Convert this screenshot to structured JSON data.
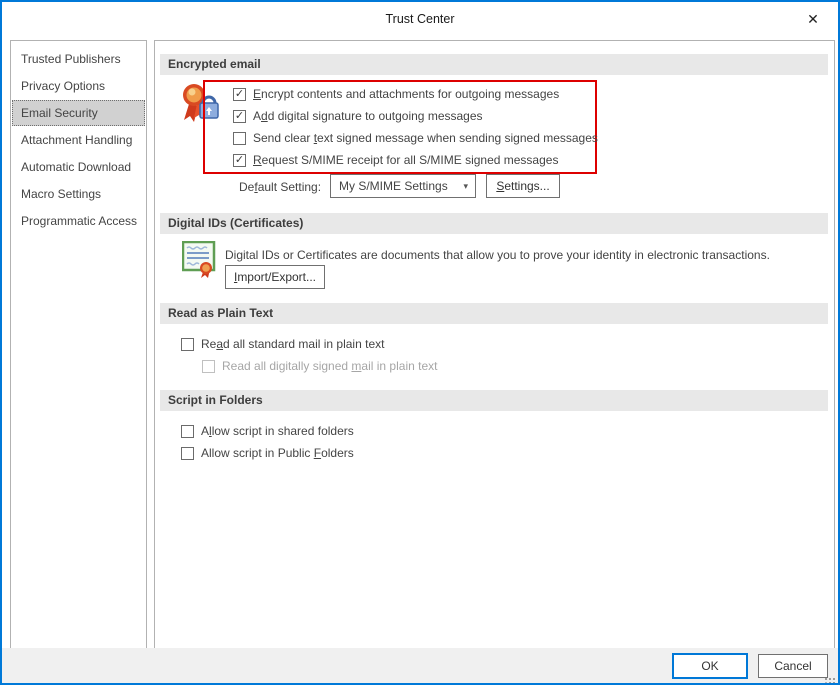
{
  "window": {
    "title": "Trust Center"
  },
  "icons": {
    "close_glyph": "✕",
    "check_glyph": "✓",
    "dropdown_arrow": "▾"
  },
  "colors": {
    "accent_blue": "#0078d7",
    "window_border": "#0079d8",
    "annotation_red": "#dd0000",
    "section_bar_gray": "#e8e8e8",
    "sidebar_selected_gray": "#d1d1d1"
  },
  "sidebar": {
    "items": [
      {
        "label": "Trusted Publishers",
        "selected": false
      },
      {
        "label": "Privacy Options",
        "selected": false
      },
      {
        "label": "Email Security",
        "selected": true
      },
      {
        "label": "Attachment Handling",
        "selected": false
      },
      {
        "label": "Automatic Download",
        "selected": false
      },
      {
        "label": "Macro Settings",
        "selected": false
      },
      {
        "label": "Programmatic Access",
        "selected": false
      }
    ]
  },
  "encrypted_email": {
    "title": "Encrypted email",
    "checkboxes": [
      {
        "pre": "",
        "key": "E",
        "post": "ncrypt contents and attachments for outgoing messages",
        "checked": true
      },
      {
        "pre": "A",
        "key": "d",
        "post": "d digital signature to outgoing messages",
        "checked": true
      },
      {
        "pre": "Send clear ",
        "key": "t",
        "post": "ext signed message when sending signed messages",
        "checked": false
      },
      {
        "pre": "",
        "key": "R",
        "post": "equest S/MIME receipt for all S/MIME signed messages",
        "checked": true
      }
    ],
    "default_setting": {
      "label_pre": "De",
      "label_key": "f",
      "label_post": "ault Setting:",
      "dropdown_value": "My S/MIME Settings",
      "settings_button": {
        "pre": "",
        "key": "S",
        "post": "ettings..."
      }
    }
  },
  "digital_ids": {
    "title": "Digital IDs (Certificates)",
    "description": "Digital IDs or Certificates are documents that allow you to prove your identity in electronic transactions.",
    "import_export_button": {
      "pre": "",
      "key": "I",
      "post": "mport/Export..."
    }
  },
  "read_plain_text": {
    "title": "Read as Plain Text",
    "checkboxes": [
      {
        "pre": "Re",
        "key": "a",
        "post": "d all standard mail in plain text",
        "checked": false,
        "disabled": false
      },
      {
        "pre": "Read all digitally signed ",
        "key": "m",
        "post": "ail in plain text",
        "checked": false,
        "disabled": true
      }
    ]
  },
  "script_folders": {
    "title": "Script in Folders",
    "checkboxes": [
      {
        "pre": "A",
        "key": "l",
        "post": "low script in shared folders",
        "checked": false
      },
      {
        "pre": "Allow script in Public ",
        "key": "F",
        "post": "olders",
        "checked": false
      }
    ]
  },
  "footer": {
    "ok_label": "OK",
    "cancel_label": "Cancel"
  }
}
